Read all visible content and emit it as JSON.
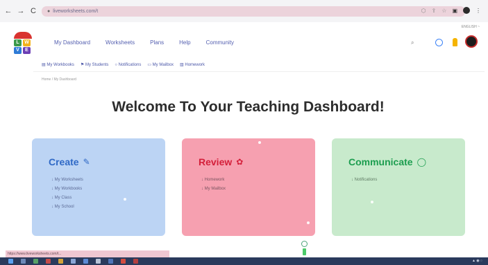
{
  "browser": {
    "back": "←",
    "forward": "→",
    "reload": "C",
    "url": "liveworksheets.com/t"
  },
  "header": {
    "language": "ENGLISH ~",
    "nav": [
      "My Dashboard",
      "Worksheets",
      "Plans",
      "Help",
      "Community"
    ]
  },
  "subnav": [
    {
      "icon": "▤",
      "label": "My Workbooks"
    },
    {
      "icon": "⚑",
      "label": "My Students"
    },
    {
      "icon": "○",
      "label": "Notifications"
    },
    {
      "icon": "▭",
      "label": "My Mailbox"
    },
    {
      "icon": "▥",
      "label": "Homework"
    }
  ],
  "breadcrumb": "Home / My Dashboard",
  "title": "Welcome To Your Teaching Dashboard!",
  "cards": {
    "create": {
      "title": "Create",
      "icon": "✎",
      "items": [
        "My Worksheets",
        "My Workbooks",
        "My Class",
        "My School"
      ]
    },
    "review": {
      "title": "Review",
      "icon": "✿",
      "items": [
        "Homework",
        "My Mailbox"
      ]
    },
    "communicate": {
      "title": "Communicate",
      "icon": "◯",
      "items": [
        "Notifications"
      ]
    }
  },
  "status_url": "https://www.liveworksheets.com/t...",
  "colors": {
    "create_bg": "#bcd4f4",
    "review_bg": "#f6a0b0",
    "communicate_bg": "#c8eacc",
    "nav_text": "#5560b0"
  }
}
